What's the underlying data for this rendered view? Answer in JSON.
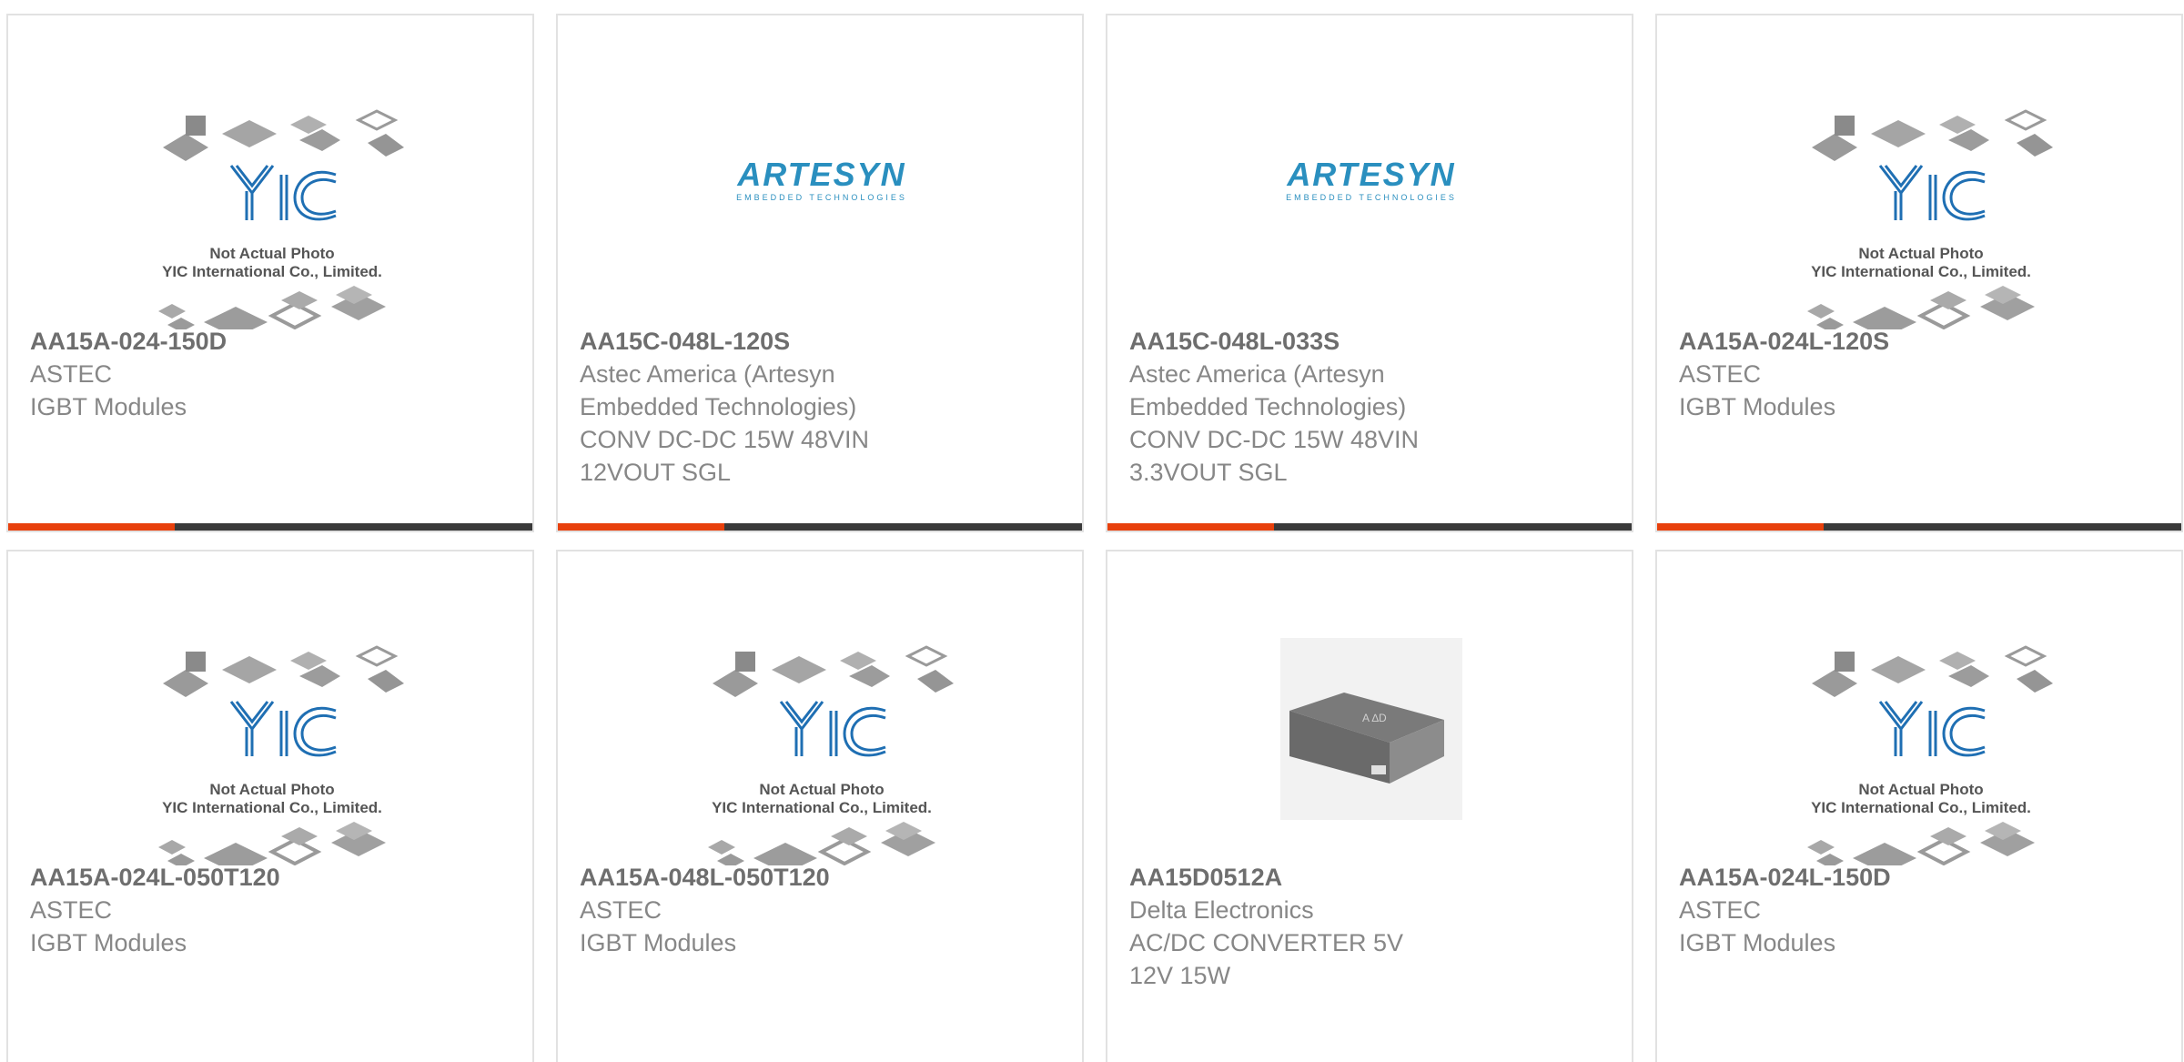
{
  "brand_colors": {
    "accent": "#e8400c",
    "bar": "#3a3a3a",
    "yic_blue": "#1f6fb3",
    "artesyn_blue": "#2a8fbf"
  },
  "placeholder_image": {
    "line1": "Not Actual Photo",
    "line2": "YIC International Co., Limited."
  },
  "artesyn_logo": {
    "main": "ARTESYN",
    "sub": "EMBEDDED TECHNOLOGIES"
  },
  "products": [
    {
      "part_no": "AA15A-024-150D",
      "maker": "ASTEC",
      "desc": "IGBT Modules",
      "image": "yic-placeholder"
    },
    {
      "part_no": "AA15C-048L-120S",
      "maker": "Astec America (Artesyn Embedded Technologies)",
      "desc": "CONV DC-DC 15W 48VIN 12VOUT SGL",
      "image": "artesyn-logo"
    },
    {
      "part_no": "AA15C-048L-033S",
      "maker": "Astec America (Artesyn Embedded Technologies)",
      "desc": "CONV DC-DC 15W 48VIN 3.3VOUT SGL",
      "image": "artesyn-logo"
    },
    {
      "part_no": "AA15A-024L-120S",
      "maker": "ASTEC",
      "desc": "IGBT Modules",
      "image": "yic-placeholder"
    },
    {
      "part_no": "AA15A-024L-050T120",
      "maker": "ASTEC",
      "desc": "IGBT Modules",
      "image": "yic-placeholder"
    },
    {
      "part_no": "AA15A-048L-050T120",
      "maker": "ASTEC",
      "desc": "IGBT Modules",
      "image": "yic-placeholder"
    },
    {
      "part_no": "AA15D0512A",
      "maker": "Delta Electronics",
      "desc": "AC/DC CONVERTER 5V 12V 15W",
      "image": "converter-module-photo"
    },
    {
      "part_no": "AA15A-024L-150D",
      "maker": "ASTEC",
      "desc": "IGBT Modules",
      "image": "yic-placeholder"
    }
  ]
}
